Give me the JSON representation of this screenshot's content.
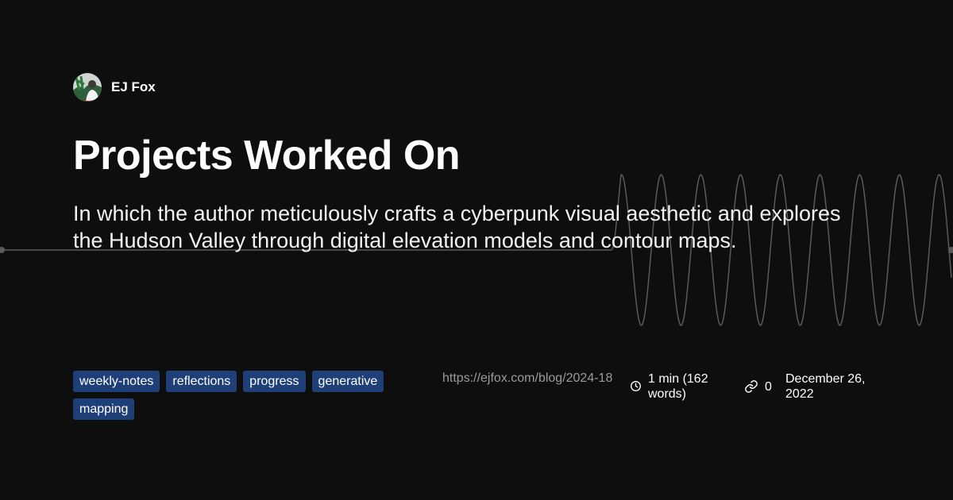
{
  "author": {
    "name": "EJ Fox",
    "avatar": "avatar"
  },
  "post": {
    "title": "Projects Worked On",
    "description": "In which the author meticulously crafts a cyberpunk visual aesthetic and explores the Hudson Valley through digital elevation models and contour maps."
  },
  "tags": [
    "weekly-notes",
    "reflections",
    "progress",
    "generative",
    "mapping"
  ],
  "meta": {
    "url": "https://ejfox.com/blog/2024-18",
    "read_time": "1 min (162 words)",
    "read_time_icon": "clock-icon",
    "link_count": "0",
    "link_icon": "link-icon",
    "date": "December 26, 2022"
  },
  "colors": {
    "background": "#0e0e0e",
    "tag_background": "#1f3f78",
    "muted_text": "#9a9a9a",
    "wave_line": "#5a5a5a"
  }
}
